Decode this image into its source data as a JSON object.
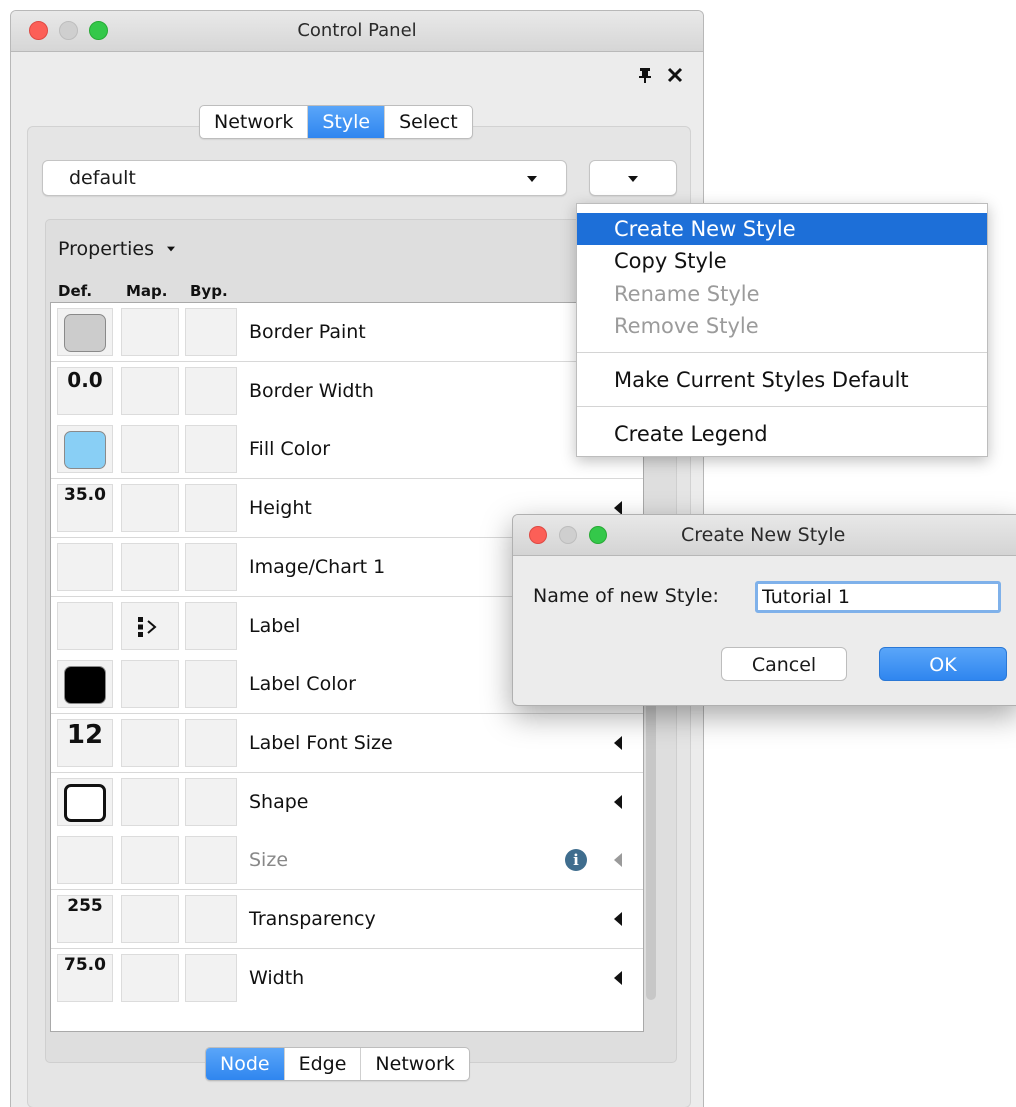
{
  "window": {
    "title": "Control Panel"
  },
  "top_tabs": [
    "Network",
    "Style",
    "Select"
  ],
  "active_top_tab": "Style",
  "style_selector": {
    "value": "default"
  },
  "properties": {
    "header": "Properties",
    "columns": [
      "Def.",
      "Map.",
      "Byp."
    ],
    "rows": [
      {
        "name": "Border Paint",
        "default": "",
        "default_kind": "swatch",
        "color": "#cccccc",
        "mapped": false,
        "enabled": true
      },
      {
        "name": "Border Width",
        "default": "0.0",
        "default_kind": "text",
        "mapped": false,
        "enabled": true
      },
      {
        "name": "Fill Color",
        "default": "",
        "default_kind": "swatch",
        "color": "#89cff5",
        "mapped": false,
        "enabled": true
      },
      {
        "name": "Height",
        "default": "35.0",
        "default_kind": "text",
        "mapped": false,
        "enabled": true
      },
      {
        "name": "Image/Chart 1",
        "default": "",
        "default_kind": "empty",
        "mapped": false,
        "enabled": true
      },
      {
        "name": "Label",
        "default": "",
        "default_kind": "empty",
        "mapped": true,
        "enabled": true
      },
      {
        "name": "Label Color",
        "default": "",
        "default_kind": "swatch",
        "color": "#000000",
        "mapped": false,
        "enabled": true
      },
      {
        "name": "Label Font Size",
        "default": "12",
        "default_kind": "text",
        "mapped": false,
        "enabled": true
      },
      {
        "name": "Shape",
        "default": "",
        "default_kind": "shape",
        "mapped": false,
        "enabled": true
      },
      {
        "name": "Size",
        "default": "",
        "default_kind": "empty",
        "mapped": false,
        "enabled": false
      },
      {
        "name": "Transparency",
        "default": "255",
        "default_kind": "text",
        "mapped": false,
        "enabled": true
      },
      {
        "name": "Width",
        "default": "75.0",
        "default_kind": "text",
        "mapped": false,
        "enabled": true
      }
    ]
  },
  "bottom_tabs": [
    "Node",
    "Edge",
    "Network"
  ],
  "active_bottom_tab": "Node",
  "context_menu": {
    "items": [
      {
        "label": "Create New Style",
        "state": "selected"
      },
      {
        "label": "Copy Style",
        "state": "enabled"
      },
      {
        "label": "Rename Style",
        "state": "disabled"
      },
      {
        "label": "Remove Style",
        "state": "disabled"
      },
      {
        "label": "Make Current Styles Default",
        "state": "enabled"
      },
      {
        "label": "Create Legend",
        "state": "enabled"
      }
    ]
  },
  "dialog": {
    "title": "Create New Style",
    "label": "Name of new Style:",
    "input_value": "Tutorial 1",
    "cancel_label": "Cancel",
    "ok_label": "OK"
  },
  "icons": {
    "pin": "pin-icon",
    "close": "close-icon",
    "dropdown": "chevron-down-icon",
    "info": "info-icon",
    "collapse": "triangle-left-icon",
    "mapping": "passthrough-mapping-icon"
  },
  "colors": {
    "accent": "#2f86ef",
    "menu_highlight": "#1d6fd8"
  }
}
